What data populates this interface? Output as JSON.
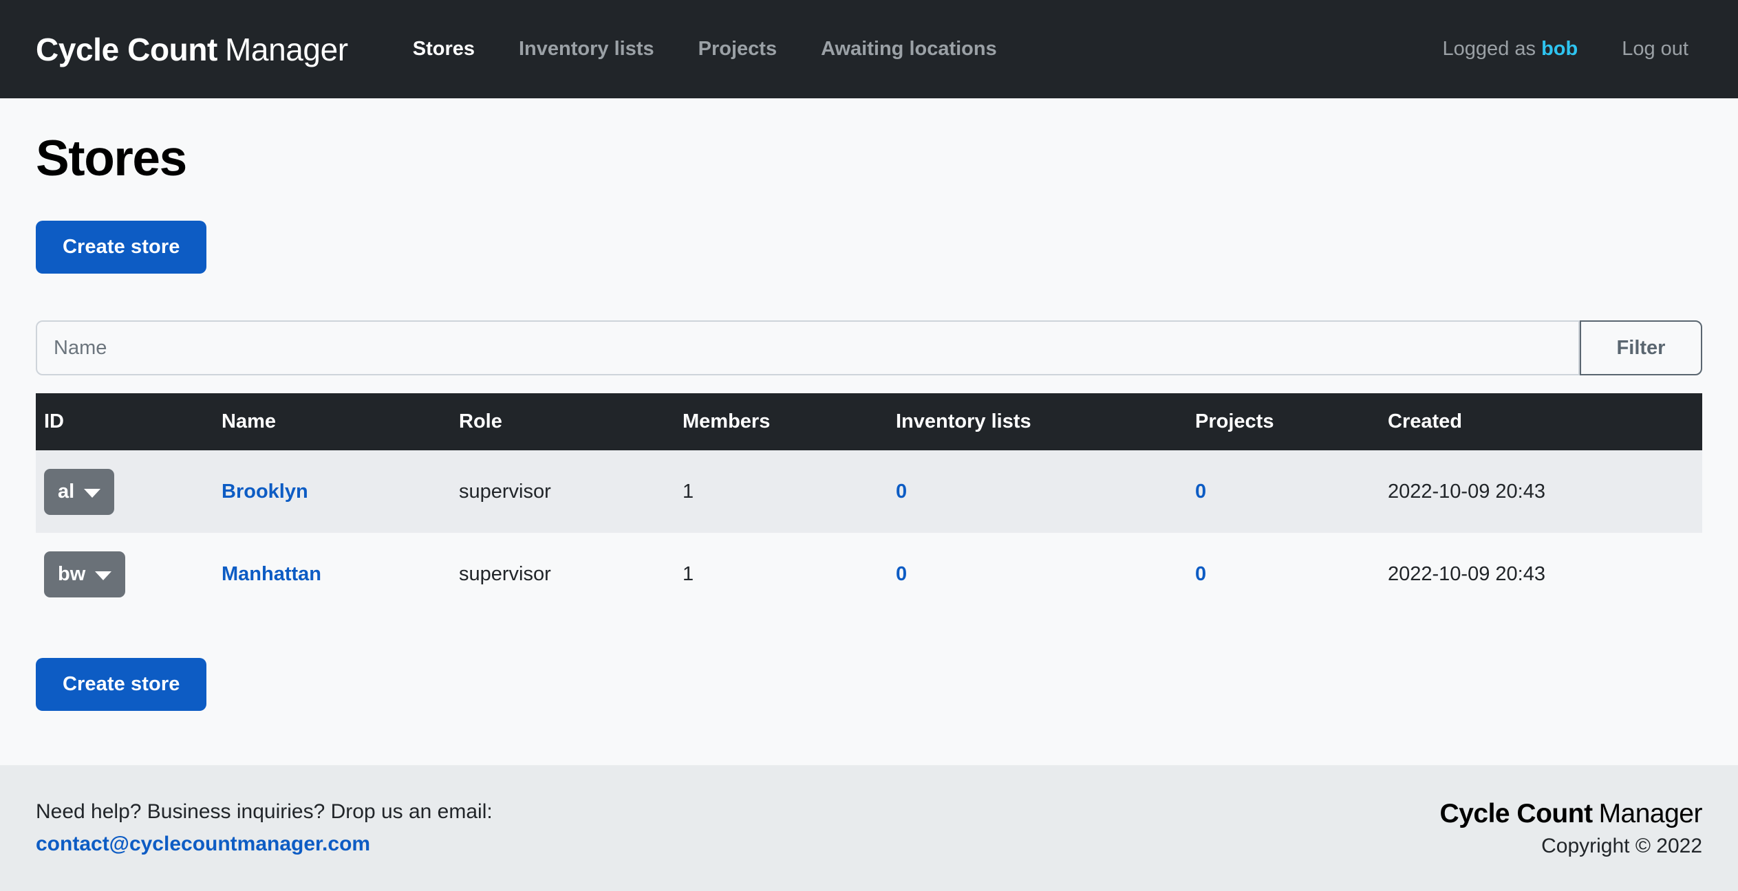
{
  "navbar": {
    "brand_strong": "Cycle Count",
    "brand_light": "Manager",
    "links": [
      {
        "label": "Stores",
        "active": true
      },
      {
        "label": "Inventory lists",
        "active": false
      },
      {
        "label": "Projects",
        "active": false
      },
      {
        "label": "Awaiting locations",
        "active": false
      }
    ],
    "logged_as_prefix": "Logged as",
    "username": "bob",
    "logout_label": "Log out"
  },
  "main": {
    "page_title": "Stores",
    "create_store_top_label": "Create store",
    "create_store_bottom_label": "Create store",
    "filter": {
      "placeholder": "Name",
      "value": "",
      "button_label": "Filter"
    },
    "table": {
      "headers": [
        "ID",
        "Name",
        "Role",
        "Members",
        "Inventory lists",
        "Projects",
        "Created"
      ],
      "rows": [
        {
          "id": "al",
          "name": "Brooklyn",
          "role": "supervisor",
          "members": "1",
          "inventory_lists": "0",
          "projects": "0",
          "created": "2022-10-09 20:43"
        },
        {
          "id": "bw",
          "name": "Manhattan",
          "role": "supervisor",
          "members": "1",
          "inventory_lists": "0",
          "projects": "0",
          "created": "2022-10-09 20:43"
        }
      ]
    }
  },
  "footer": {
    "help_text": "Need help? Business inquiries? Drop us an email:",
    "email": "contact@cyclecountmanager.com",
    "brand_strong": "Cycle Count",
    "brand_light": "Manager",
    "copyright": "Copyright © 2022"
  },
  "colors": {
    "navbar_bg": "#212529",
    "primary": "#0d5cc4",
    "accent_username": "#2ec4f0",
    "secondary_btn": "#6a7178",
    "page_bg": "#f8f9fa",
    "footer_bg": "#e8ebed",
    "row_striped": "#eaecef"
  }
}
